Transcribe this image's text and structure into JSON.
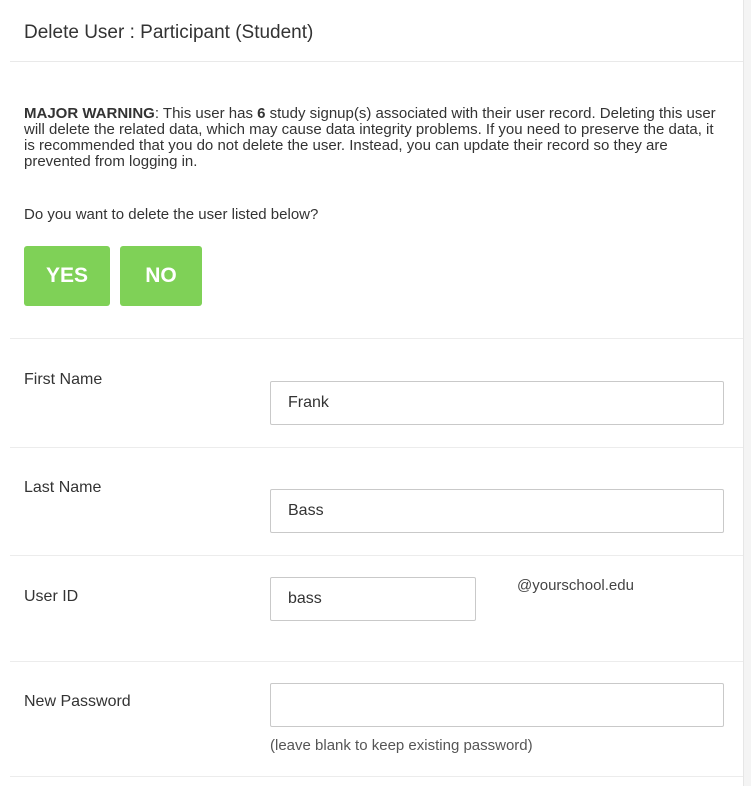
{
  "header": {
    "title": "Delete User : Participant (Student)"
  },
  "warning": {
    "label": "MAJOR WARNING",
    "text_before_count": ": This user has ",
    "count": "6",
    "text_after_count": " study signup(s) associated with their user record. Deleting this user will delete the related data, which may cause data integrity problems. If you need to preserve the data, it is recommended that you do not delete the user. Instead, you can update their record so they are prevented from logging in."
  },
  "question": "Do you want to delete the user listed below?",
  "buttons": {
    "yes": "YES",
    "no": "NO"
  },
  "form": {
    "first_name": {
      "label": "First Name",
      "value": "Frank"
    },
    "last_name": {
      "label": "Last Name",
      "value": "Bass"
    },
    "user_id": {
      "label": "User ID",
      "value": "bass",
      "suffix": "@yourschool.edu"
    },
    "new_password": {
      "label": "New Password",
      "value": "",
      "hint": "(leave blank to keep existing password)"
    }
  },
  "colors": {
    "button_green": "#7fd157"
  }
}
